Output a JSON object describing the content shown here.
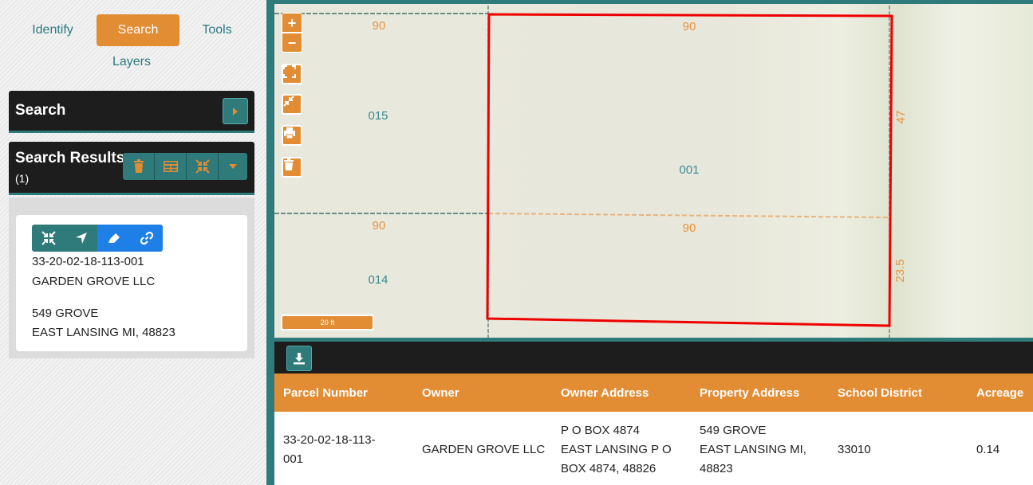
{
  "tabs": {
    "identify": "Identify",
    "search": "Search",
    "tools": "Tools",
    "layers": "Layers"
  },
  "search_panel": {
    "title": "Search"
  },
  "results_panel": {
    "title": "Search Results",
    "count": "(1)"
  },
  "result_card": {
    "parcel": "33-20-02-18-113-001",
    "owner": "GARDEN GROVE LLC",
    "address_line1": "549 GROVE",
    "address_line2": "EAST LANSING MI, 48823"
  },
  "map": {
    "zoom_in": "+",
    "zoom_out": "−",
    "scale_label": "20 ft",
    "labels": {
      "top_left_90": "90",
      "top_right_90": "90",
      "mid_left_90": "90",
      "mid_right_90": "90",
      "parcel_015": "015",
      "parcel_014": "014",
      "parcel_001": "001",
      "side_47": "47",
      "side_23_5": "23.5"
    },
    "colors": {
      "selection": "#ee0000",
      "label": "#e8923e",
      "parcel_label": "#3b8a92"
    }
  },
  "table": {
    "headers": [
      "Parcel Number",
      "Owner",
      "Owner Address",
      "Property Address",
      "School District",
      "Acreage"
    ],
    "row": {
      "parcel_1": "33-20-02-18-113-",
      "parcel_2": "001",
      "owner": "GARDEN GROVE LLC",
      "owner_address_1": "P O BOX 4874",
      "owner_address_2": "EAST LANSING P O",
      "owner_address_3": "BOX 4874, 48826",
      "property_address_1": "549 GROVE",
      "property_address_2": "EAST LANSING MI,",
      "property_address_3": "48823",
      "school_district": "33010",
      "acreage": "0.14"
    }
  },
  "colors": {
    "accent": "#e28c33",
    "teal": "#2f7a7a",
    "dark": "#1d1d1d",
    "link_blue": "#1e7fe6"
  }
}
